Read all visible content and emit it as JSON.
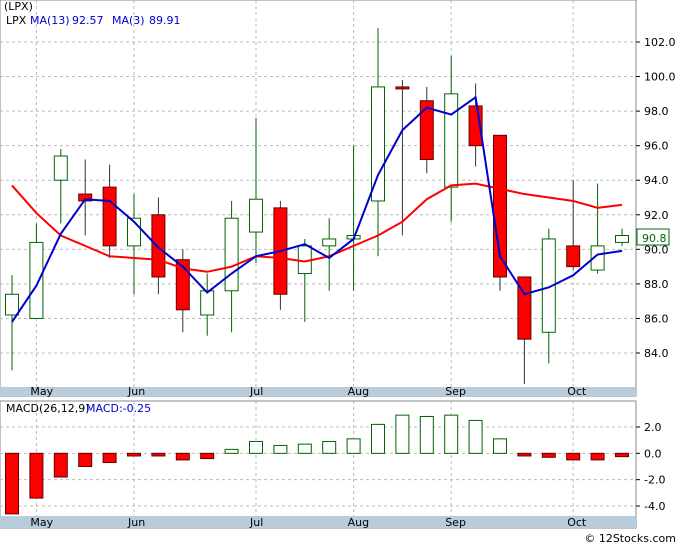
{
  "header": {
    "symbol_label": "(LPX)",
    "ticker": "LPX",
    "ma13_label": "MA(13)",
    "ma13_value": "92.57",
    "ma3_label": "MA(3)",
    "ma3_value": "89.91"
  },
  "macd_header": {
    "label": "MACD(26,12,9)",
    "value_label": "MACD:-0.25"
  },
  "last_price_tag": "90.8",
  "watermark": "© 12Stocks.com",
  "colors": {
    "up": "#006400",
    "down": "#ff0000",
    "ma13": "#ff0000",
    "ma3": "#0000cc",
    "axis_band": "#b8ccdc",
    "grid": "#bbbbbb",
    "macd_pos": "#006400",
    "macd_neg": "#ff0000"
  },
  "chart_data": [
    {
      "type": "candlestick",
      "title": "(LPX)",
      "x_tick_labels": [
        "May",
        "Jun",
        "Jul",
        "Aug",
        "Sep",
        "Oct"
      ],
      "y_tick_labels": [
        "84.0",
        "86.0",
        "88.0",
        "90.0",
        "92.0",
        "94.0",
        "96.0",
        "98.0",
        "100.0",
        "102.0"
      ],
      "ylim": [
        82,
        103
      ],
      "grid": true,
      "candles": [
        {
          "o": 86.2,
          "h": 88.5,
          "l": 83.0,
          "c": 87.4
        },
        {
          "o": 86.0,
          "h": 91.5,
          "l": 86.0,
          "c": 90.4
        },
        {
          "o": 94.0,
          "h": 95.8,
          "l": 91.5,
          "c": 95.4
        },
        {
          "o": 93.2,
          "h": 95.2,
          "l": 90.8,
          "c": 92.8
        },
        {
          "o": 93.6,
          "h": 94.9,
          "l": 89.5,
          "c": 90.2
        },
        {
          "o": 90.2,
          "h": 93.2,
          "l": 87.4,
          "c": 91.8
        },
        {
          "o": 92.0,
          "h": 93.0,
          "l": 87.4,
          "c": 88.4
        },
        {
          "o": 89.4,
          "h": 90.0,
          "l": 85.2,
          "c": 86.5
        },
        {
          "o": 86.2,
          "h": 88.6,
          "l": 85.0,
          "c": 87.6
        },
        {
          "o": 87.6,
          "h": 92.8,
          "l": 85.2,
          "c": 91.8
        },
        {
          "o": 91.0,
          "h": 97.6,
          "l": 89.2,
          "c": 92.9
        },
        {
          "o": 92.4,
          "h": 92.8,
          "l": 86.5,
          "c": 87.4
        },
        {
          "o": 88.6,
          "h": 90.6,
          "l": 85.8,
          "c": 90.2
        },
        {
          "o": 90.2,
          "h": 91.8,
          "l": 87.6,
          "c": 90.6
        },
        {
          "o": 90.6,
          "h": 96.0,
          "l": 87.6,
          "c": 90.8
        },
        {
          "o": 92.8,
          "h": 102.8,
          "l": 89.6,
          "c": 99.4
        },
        {
          "o": 99.4,
          "h": 99.8,
          "l": 90.8,
          "c": 99.3
        },
        {
          "o": 98.6,
          "h": 99.4,
          "l": 94.4,
          "c": 95.2
        },
        {
          "o": 93.6,
          "h": 101.2,
          "l": 91.6,
          "c": 99.0
        },
        {
          "o": 98.3,
          "h": 99.6,
          "l": 94.8,
          "c": 96.0
        },
        {
          "o": 96.6,
          "h": 96.6,
          "l": 87.6,
          "c": 88.4
        },
        {
          "o": 88.4,
          "h": 88.4,
          "l": 82.2,
          "c": 84.8
        },
        {
          "o": 85.2,
          "h": 91.2,
          "l": 83.4,
          "c": 90.6
        },
        {
          "o": 90.2,
          "h": 94.0,
          "l": 88.8,
          "c": 89.0
        },
        {
          "o": 88.8,
          "h": 93.8,
          "l": 88.6,
          "c": 90.2
        },
        {
          "o": 90.4,
          "h": 91.2,
          "l": 90.2,
          "c": 90.8
        }
      ],
      "series": [
        {
          "name": "MA(13)",
          "values": [
            93.7,
            92.1,
            90.8,
            90.2,
            89.6,
            89.5,
            89.4,
            88.9,
            88.7,
            89.0,
            89.6,
            89.5,
            89.3,
            89.6,
            90.2,
            90.8,
            91.6,
            92.9,
            93.7,
            93.8,
            93.5,
            93.2,
            93.0,
            92.8,
            92.4,
            92.57
          ]
        },
        {
          "name": "MA(3)",
          "values": [
            85.8,
            87.9,
            90.9,
            92.9,
            92.8,
            91.6,
            90.1,
            89.0,
            87.5,
            88.6,
            89.6,
            89.9,
            90.3,
            89.5,
            90.6,
            94.3,
            96.9,
            98.2,
            97.8,
            98.8,
            89.6,
            87.4,
            87.8,
            88.5,
            89.7,
            89.91
          ]
        }
      ]
    },
    {
      "type": "bar",
      "title": "MACD(26,12,9)",
      "x_tick_labels": [
        "May",
        "Jun",
        "Jul",
        "Aug",
        "Sep",
        "Oct"
      ],
      "y_tick_labels": [
        "-4.0",
        "-2.0",
        "0.0",
        "2.0"
      ],
      "ylim": [
        -4.6,
        3.4
      ],
      "values": [
        -4.6,
        -3.4,
        -1.8,
        -1.0,
        -0.7,
        -0.2,
        -0.2,
        -0.5,
        -0.4,
        0.3,
        0.9,
        0.6,
        0.7,
        0.9,
        1.1,
        2.2,
        2.9,
        2.8,
        2.9,
        2.5,
        1.1,
        -0.2,
        -0.3,
        -0.5,
        -0.5,
        -0.25
      ]
    }
  ]
}
